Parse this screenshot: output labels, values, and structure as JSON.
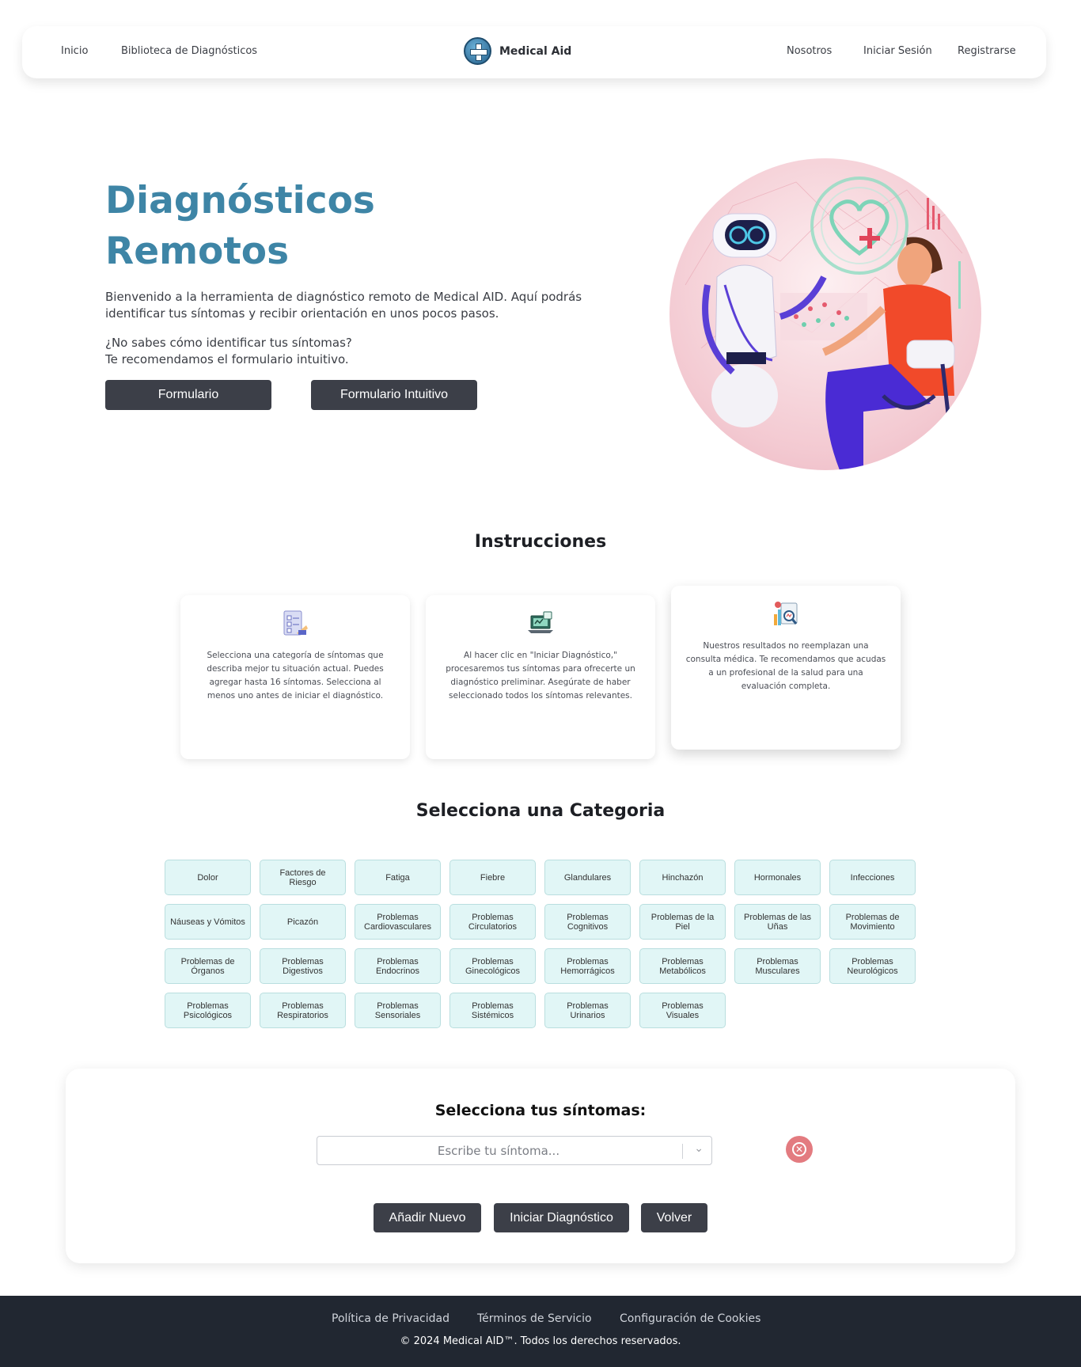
{
  "nav": {
    "inicio": "Inicio",
    "biblioteca": "Biblioteca de Diagnósticos",
    "brand": "Medical Aid",
    "nosotros": "Nosotros",
    "login": "Iniciar Sesión",
    "register": "Registrarse"
  },
  "hero": {
    "title_line1": "Diagnósticos",
    "title_line2": "Remotos",
    "intro": "Bienvenido a la herramienta de diagnóstico remoto de Medical AID. Aquí podrás identificar tus síntomas y recibir orientación en unos pocos pasos.",
    "question_line1": "¿No sabes cómo identificar tus síntomas?",
    "question_line2": "Te recomendamos el formulario intuitivo.",
    "btn_form": "Formulario",
    "btn_intuitive": "Formulario Intuitivo"
  },
  "instructions": {
    "title": "Instrucciones",
    "cards": [
      {
        "icon": "checklist-icon",
        "text": "Selecciona una categoría de síntomas que describa mejor tu situación actual. Puedes agregar hasta 16 síntomas. Selecciona al menos uno antes de iniciar el diagnóstico."
      },
      {
        "icon": "laptop-diagnosis-icon",
        "text": "Al hacer clic en \"Iniciar Diagnóstico,\" procesaremos tus síntomas para ofrecerte un diagnóstico preliminar. Asegúrate de haber seleccionado todos los síntomas relevantes."
      },
      {
        "icon": "report-search-icon",
        "text": "Nuestros resultados no reemplazan una consulta médica. Te recomendamos que acudas a un profesional de la salud para una evaluación completa."
      }
    ]
  },
  "categories": {
    "title": "Selecciona una Categoria",
    "items": [
      "Dolor",
      "Factores de Riesgo",
      "Fatiga",
      "Fiebre",
      "Glandulares",
      "Hinchazón",
      "Hormonales",
      "Infecciones",
      "Náuseas y Vómitos",
      "Picazón",
      "Problemas Cardiovasculares",
      "Problemas Circulatorios",
      "Problemas Cognitivos",
      "Problemas de la Piel",
      "Problemas de las Uñas",
      "Problemas de Movimiento",
      "Problemas de Órganos",
      "Problemas Digestivos",
      "Problemas Endocrinos",
      "Problemas Ginecológicos",
      "Problemas Hemorrágicos",
      "Problemas Metabólicos",
      "Problemas Musculares",
      "Problemas Neurológicos",
      "Problemas Psicológicos",
      "Problemas Respiratorios",
      "Problemas Sensoriales",
      "Problemas Sistémicos",
      "Problemas Urinarios",
      "Problemas Visuales"
    ]
  },
  "symptoms": {
    "title": "Selecciona tus síntomas:",
    "placeholder": "Escribe tu síntoma...",
    "btn_add": "Añadir Nuevo",
    "btn_start": "Iniciar Diagnóstico",
    "btn_back": "Volver"
  },
  "footer": {
    "privacy": "Política de Privacidad",
    "terms": "Términos de Servicio",
    "cookies": "Configuración de Cookies",
    "copyright": "© 2024 Medical AID™. Todos los derechos reservados."
  },
  "colors": {
    "title_blue": "#3e85a6",
    "button_dark": "#3c3f48",
    "category_bg": "#e1f6f6",
    "clear_red": "#e37b80",
    "footer_bg": "#212731"
  }
}
